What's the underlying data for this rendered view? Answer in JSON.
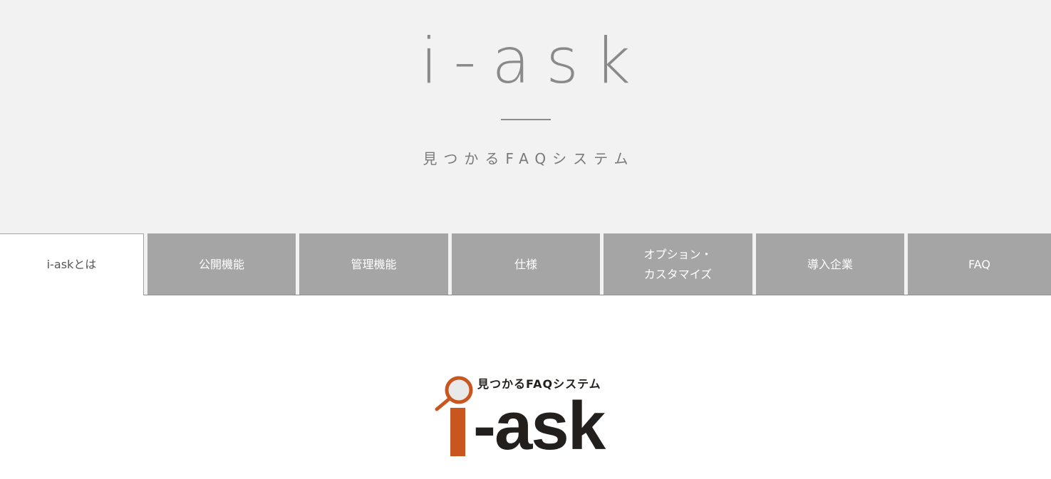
{
  "hero": {
    "title": "i-ask",
    "subtitle": "見つかるFAQシステム"
  },
  "tabs": [
    {
      "label": "i-askとは",
      "active": true
    },
    {
      "label": "公開機能",
      "active": false
    },
    {
      "label": "管理機能",
      "active": false
    },
    {
      "label": "仕様",
      "active": false
    },
    {
      "label_line1": "オプション・",
      "label_line2": "カスタマイズ",
      "active": false
    },
    {
      "label": "導入企業",
      "active": false
    },
    {
      "label": "FAQ",
      "active": false
    }
  ],
  "logo": {
    "tagline": "見つかるFAQシステム",
    "wordmark": "-ask",
    "icon": "magnifier-i-icon",
    "accent_color": "#c8561e",
    "text_color": "#231f1c"
  },
  "colors": {
    "hero_bg": "#f2f2f2",
    "tab_bg": "#a5a5a5",
    "title_gray": "#8a8a8a"
  }
}
